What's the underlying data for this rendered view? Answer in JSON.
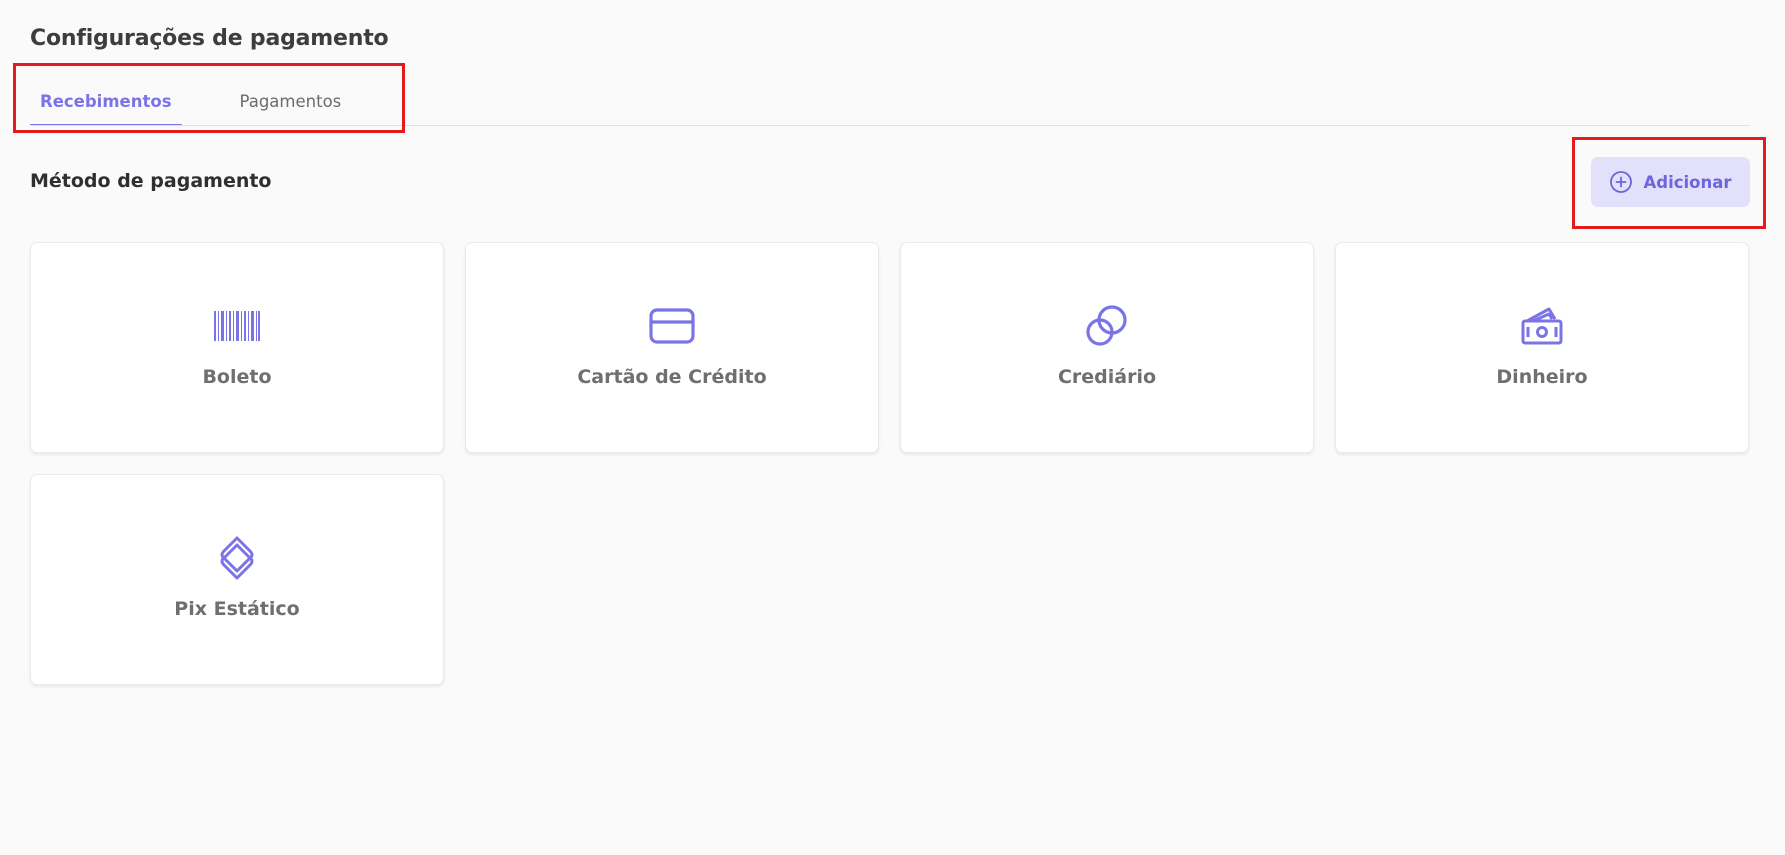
{
  "page": {
    "title": "Configurações de pagamento"
  },
  "tabs": [
    {
      "label": "Recebimentos",
      "active": true
    },
    {
      "label": "Pagamentos",
      "active": false
    }
  ],
  "section": {
    "title": "Método de pagamento"
  },
  "add_button": {
    "label": "Adicionar",
    "icon": "plus-circle-icon"
  },
  "payment_methods": [
    {
      "label": "Boleto",
      "icon": "barcode-icon"
    },
    {
      "label": "Cartão de Crédito",
      "icon": "credit-card-icon"
    },
    {
      "label": "Crediário",
      "icon": "coins-icon"
    },
    {
      "label": "Dinheiro",
      "icon": "cash-icon"
    },
    {
      "label": "Pix Estático",
      "icon": "pix-icon"
    }
  ],
  "colors": {
    "accent": "#7b74e6",
    "button_bg": "#e2e0fb",
    "highlight": "#e31b1b",
    "background": "#fafafa"
  }
}
